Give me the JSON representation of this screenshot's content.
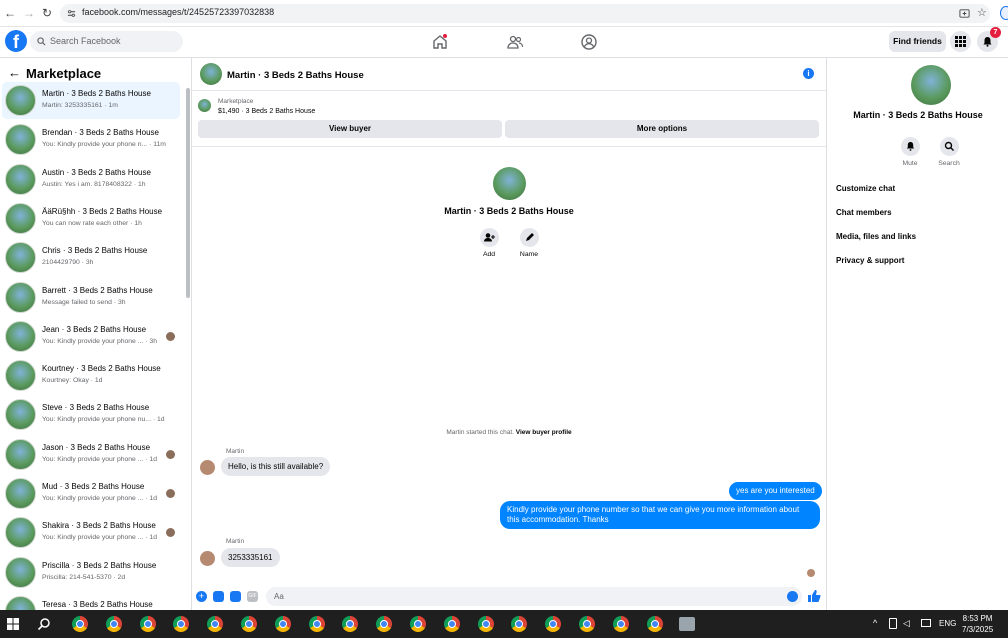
{
  "browser": {
    "url": "facebook.com/messages/t/24525723397032838"
  },
  "header": {
    "search_placeholder": "Search Facebook",
    "find_friends": "Find friends",
    "notification_count": "7"
  },
  "sidebar": {
    "title": "Marketplace",
    "conversations": [
      {
        "name": "Martin · 3 Beds 2 Baths House",
        "preview": "Martin: 3253335161 · 1m"
      },
      {
        "name": "Brendan · 3 Beds 2 Baths House",
        "preview": "You: Kindly provide your phone n... · 11m"
      },
      {
        "name": "Austin · 3 Beds 2 Baths House",
        "preview": "Austin: Yes i am. 8178408322 · 1h"
      },
      {
        "name": "ÄäRü§hh · 3 Beds 2 Baths House",
        "preview": "You can now rate each other · 1h"
      },
      {
        "name": "Chris · 3 Beds 2 Baths House",
        "preview": "2104429790 · 3h"
      },
      {
        "name": "Barrett · 3 Beds 2 Baths House",
        "preview": "Message failed to send · 3h"
      },
      {
        "name": "Jean · 3 Beds 2 Baths House",
        "preview": "You: Kindly provide your phone ... · 3h"
      },
      {
        "name": "Kourtney · 3 Beds 2 Baths House",
        "preview": "Kourtney: Okay · 1d"
      },
      {
        "name": "Steve · 3 Beds 2 Baths House",
        "preview": "You: Kindly provide your phone nu... · 1d"
      },
      {
        "name": "Jason · 3 Beds 2 Baths House",
        "preview": "You: Kindly provide your phone ... · 1d"
      },
      {
        "name": "Mud · 3 Beds 2 Baths House",
        "preview": "You: Kindly provide your phone ... · 1d"
      },
      {
        "name": "Shakira · 3 Beds 2 Baths House",
        "preview": "You: Kindly provide your phone ... · 1d"
      },
      {
        "name": "Priscilla · 3 Beds 2 Baths House",
        "preview": "Priscilla: 214-541-5370 · 2d"
      },
      {
        "name": "Teresa · 3 Beds 2 Baths House",
        "preview": ""
      }
    ]
  },
  "chat": {
    "title": "Martin · 3 Beds 2 Baths House",
    "marketplace_label": "Marketplace",
    "listing": "$1,490 · 3 Beds 2 Baths House",
    "view_buyer": "View buyer",
    "more_options": "More options",
    "center_name": "Martin · 3 Beds 2 Baths House",
    "add_label": "Add",
    "name_label": "Name",
    "started_text": "Martin started this chat.",
    "view_buyer_profile": "View buyer profile",
    "sender_name": "Martin",
    "msg_in_1": "Hello, is this still available?",
    "msg_out_1": "yes are you interested",
    "msg_out_2_line1": "Kindly provide your phone number so that we can give you more information about",
    "msg_out_2_line2": "this accommodation. Thanks",
    "msg_in_2": "3253335161",
    "composer_placeholder": "Aa"
  },
  "details": {
    "name": "Martin · 3 Beds 2 Baths House",
    "mute": "Mute",
    "search": "Search",
    "items": [
      "Customize chat",
      "Chat members",
      "Media, files and links",
      "Privacy & support"
    ]
  },
  "taskbar": {
    "lang": "ENG",
    "time": "8:53 PM",
    "date": "7/3/2025"
  }
}
